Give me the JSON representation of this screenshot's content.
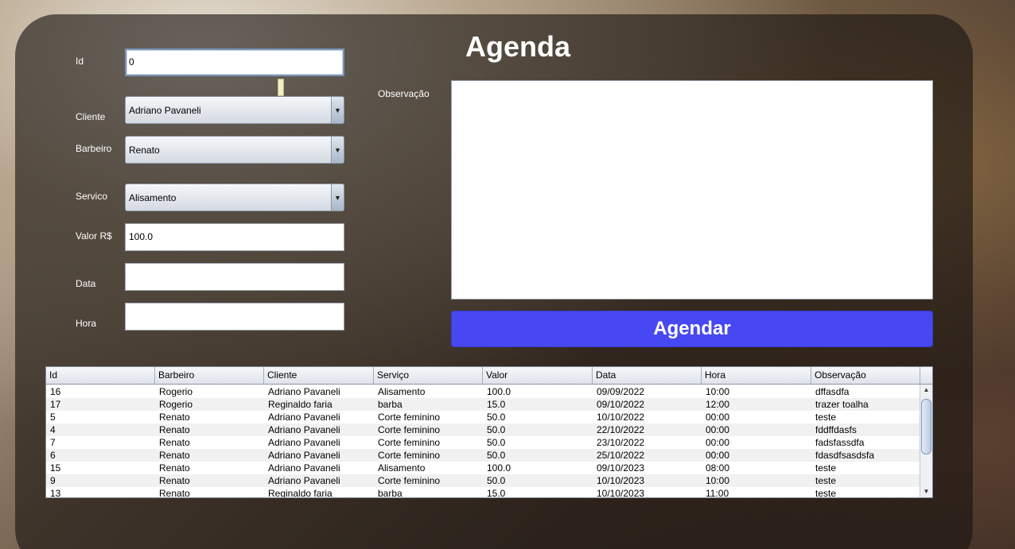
{
  "title": "Agenda",
  "form": {
    "id": {
      "label": "Id",
      "value": "0"
    },
    "cliente": {
      "label": "Cliente",
      "value": "Adriano Pavaneli"
    },
    "barbeiro": {
      "label": "Barbeiro",
      "value": "Renato"
    },
    "servico": {
      "label": "Servico",
      "value": "Alisamento"
    },
    "valor": {
      "label": "Valor R$",
      "value": "100.0"
    },
    "data": {
      "label": "Data",
      "value": ""
    },
    "hora": {
      "label": "Hora",
      "value": ""
    },
    "observacao": {
      "label": "Observação",
      "value": ""
    }
  },
  "agendar_label": "Agendar",
  "combo_arrow_icon": "chevron-down-icon",
  "colors": {
    "button": "#4848f2",
    "panel": "rgba(25,20,16,0.62)"
  },
  "table": {
    "columns": [
      "Id",
      "Barbeiro",
      "Cliente",
      "Serviço",
      "Valor",
      "Data",
      "Hora",
      "Observação"
    ],
    "rows": [
      [
        "16",
        "Rogerio",
        "Adriano Pavaneli",
        "Alisamento",
        "100.0",
        "09/09/2022",
        "10:00",
        "dffasdfa"
      ],
      [
        "17",
        "Rogerio",
        "Reginaldo faria",
        "barba",
        "15.0",
        "09/10/2022",
        "12:00",
        "trazer toalha"
      ],
      [
        "5",
        "Renato",
        "Adriano Pavaneli",
        "Corte feminino",
        "50.0",
        "10/10/2022",
        "00:00",
        "teste"
      ],
      [
        "4",
        "Renato",
        "Adriano Pavaneli",
        "Corte feminino",
        "50.0",
        "22/10/2022",
        "00:00",
        "fddffdasfs"
      ],
      [
        "7",
        "Renato",
        "Adriano Pavaneli",
        "Corte feminino",
        "50.0",
        "23/10/2022",
        "00:00",
        "fadsfassdfa"
      ],
      [
        "6",
        "Renato",
        "Adriano Pavaneli",
        "Corte feminino",
        "50.0",
        "25/10/2022",
        "00:00",
        "fdasdfsasdsfa"
      ],
      [
        "15",
        "Renato",
        "Adriano Pavaneli",
        "Alisamento",
        "100.0",
        "09/10/2023",
        "08:00",
        "teste"
      ],
      [
        "9",
        "Renato",
        "Adriano Pavaneli",
        "Corte feminino",
        "50.0",
        "10/10/2023",
        "10:00",
        "teste"
      ],
      [
        "13",
        "Renato",
        "Reginaldo faria",
        "barba",
        "15.0",
        "10/10/2023",
        "11:00",
        "teste"
      ]
    ]
  }
}
